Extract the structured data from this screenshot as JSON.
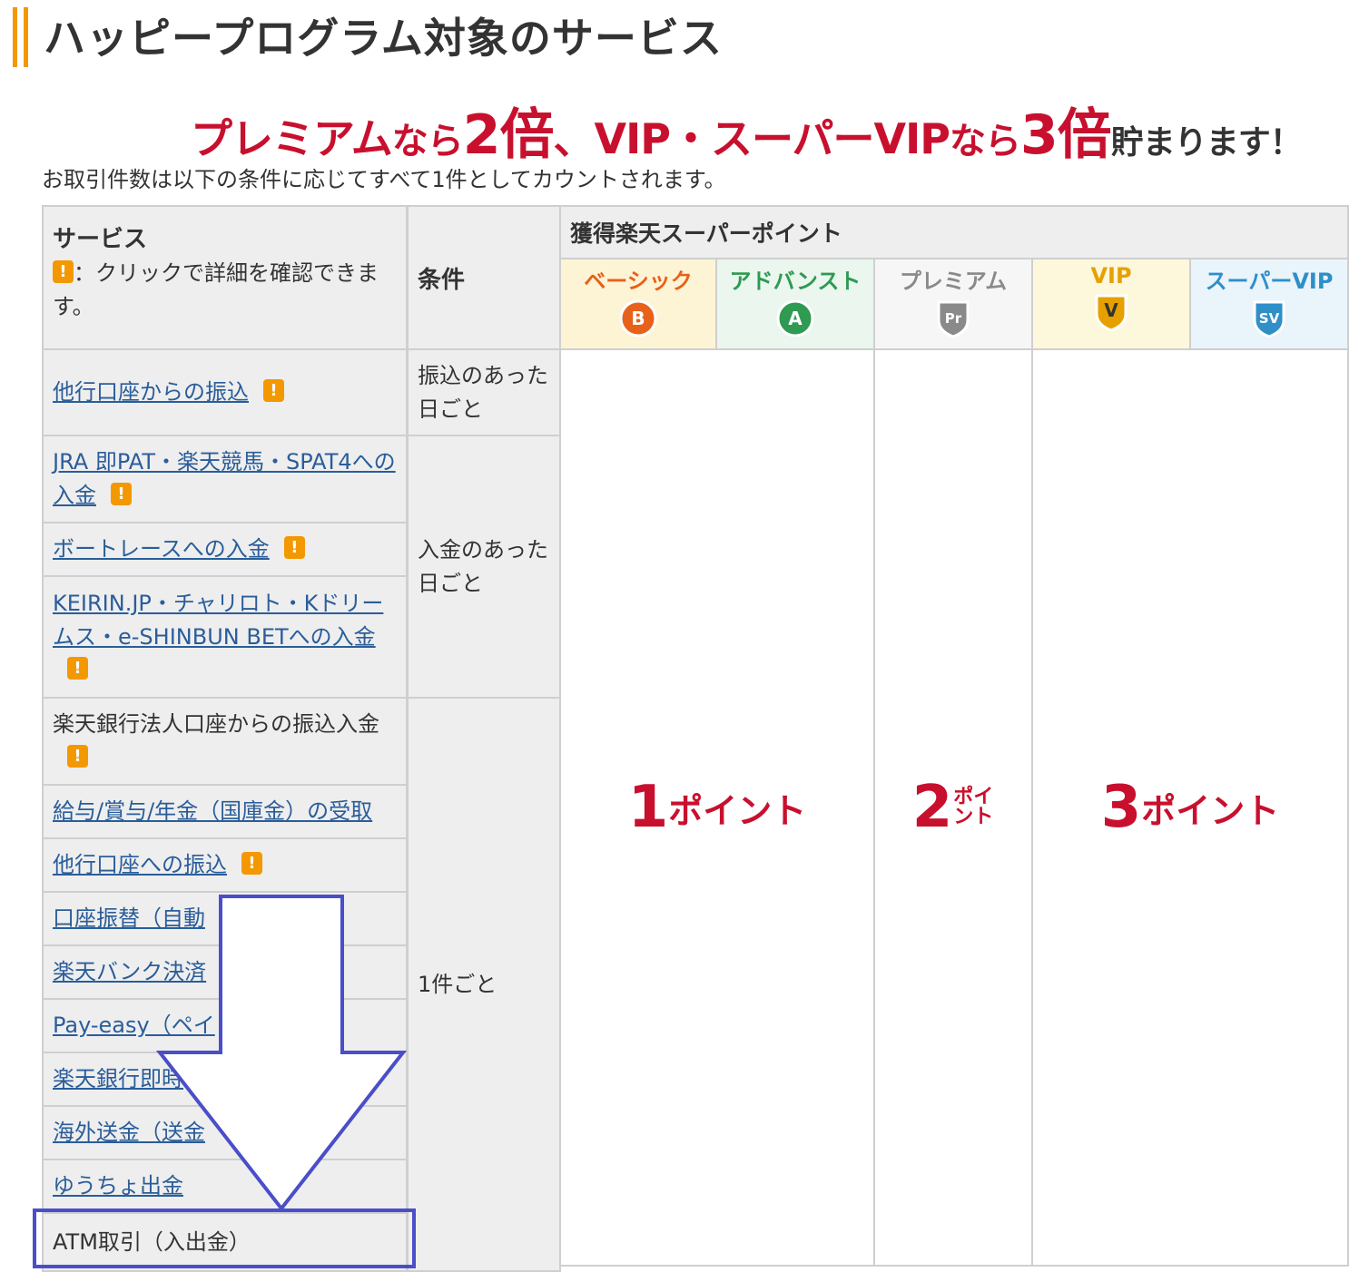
{
  "page": {
    "title": "ハッピープログラム対象のサービス",
    "banner": {
      "part1": "プレミアム",
      "part2": "なら",
      "part3": "2倍",
      "part4": "、VIP・スーパーVIP",
      "part5": "なら",
      "part6": "3倍",
      "part7": "貯まります！"
    },
    "note": "お取引件数は以下の条件に応じてすべて1件としてカウントされます。"
  },
  "table": {
    "header": {
      "service_label": "サービス",
      "service_note": "：クリックで詳細を確認できます。",
      "condition_label": "条件",
      "points_label": "獲得楽天スーパーポイント"
    },
    "ranks": [
      {
        "name": "ベーシック",
        "badge": "B",
        "color": "#e8611a",
        "bg": "#fdf4d6"
      },
      {
        "name": "アドバンスト",
        "badge": "A",
        "color": "#2e9a52",
        "bg": "#eaf6ee"
      },
      {
        "name": "プレミアム",
        "badge": "Pr",
        "color": "#8a8a8a",
        "bg": "#f6f6f6"
      },
      {
        "name": "VIP",
        "badge": "V",
        "color": "#e6a100",
        "bg": "#fdf7dc"
      },
      {
        "name": "スーパーVIP",
        "badge": "SV",
        "color": "#2f8fc8",
        "bg": "#eaf4fb"
      }
    ],
    "services": [
      {
        "label": "他行口座からの振込"
      },
      {
        "label": "JRA 即PAT・楽天競馬・SPAT4への入金"
      },
      {
        "label": "ボートレースへの入金"
      },
      {
        "label": "KEIRIN.JP・チャリロト・Kドリームス・e-SHINBUN BETへの入金"
      },
      {
        "label": "楽天銀行法人口座からの振込入金"
      },
      {
        "label": "給与/賞与/年金（国庫金）の受取"
      },
      {
        "label": "他行口座への振込"
      },
      {
        "label": "口座振替（自動"
      },
      {
        "label": "楽天バンク決済"
      },
      {
        "label": "Pay-easy（ペイ"
      },
      {
        "label": "楽天銀行即時"
      },
      {
        "label": "海外送金（送金"
      },
      {
        "label": "ゆうちょ出金"
      },
      {
        "label": "ATM取引（入出金）"
      }
    ],
    "conditions": [
      {
        "label": "振込のあった日ごと"
      },
      {
        "label": "入金のあった日ごと"
      },
      {
        "label": "1件ごと"
      }
    ],
    "points": [
      {
        "num": "1",
        "unit": "ポイント"
      },
      {
        "num": "2",
        "unit": "ポイント"
      },
      {
        "num": "3",
        "unit": "ポイント"
      }
    ]
  },
  "annotation": {
    "arrow_color": "#4a4ec8",
    "highlight_color": "#4a4ec8"
  }
}
